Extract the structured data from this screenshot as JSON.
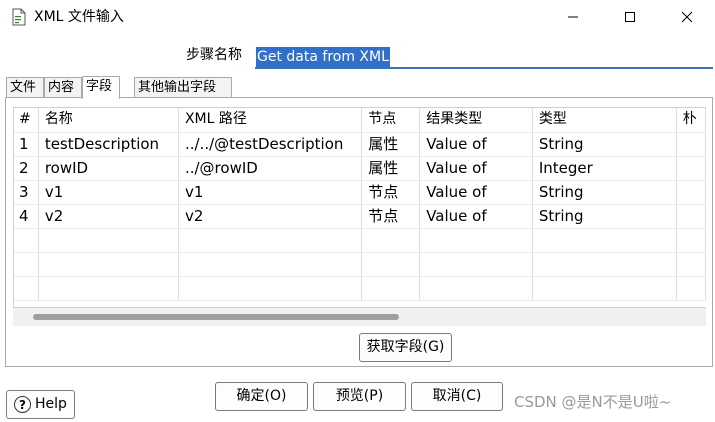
{
  "window": {
    "title": "XML 文件输入",
    "app_icon": "document-icon"
  },
  "step": {
    "label": "步骤名称",
    "value": "Get data from XML"
  },
  "tabs": [
    {
      "label": "文件",
      "active": false
    },
    {
      "label": "内容",
      "active": false
    },
    {
      "label": "字段",
      "active": true
    },
    {
      "label": "其他输出字段",
      "active": false
    }
  ],
  "table": {
    "columns": [
      "#",
      "名称",
      "XML 路径",
      "节点",
      "结果类型",
      "类型",
      "朴"
    ],
    "rows": [
      [
        "1",
        "testDescription",
        "../../@testDescription",
        "属性",
        "Value of",
        "String"
      ],
      [
        "2",
        "rowID",
        "../@rowID",
        "属性",
        "Value of",
        "Integer"
      ],
      [
        "3",
        "v1",
        "v1",
        "节点",
        "Value of",
        "String"
      ],
      [
        "4",
        "v2",
        "v2",
        "节点",
        "Value of",
        "String"
      ]
    ]
  },
  "buttons": {
    "fetch_fields": "获取字段(G)",
    "help": "Help",
    "ok": "确定(O)",
    "preview": "预览(P)",
    "cancel": "取消(C)"
  },
  "watermark": "CSDN @是N不是U啦~",
  "colors": {
    "selection": "#3070c8",
    "input_underline": "#3c73b6"
  }
}
